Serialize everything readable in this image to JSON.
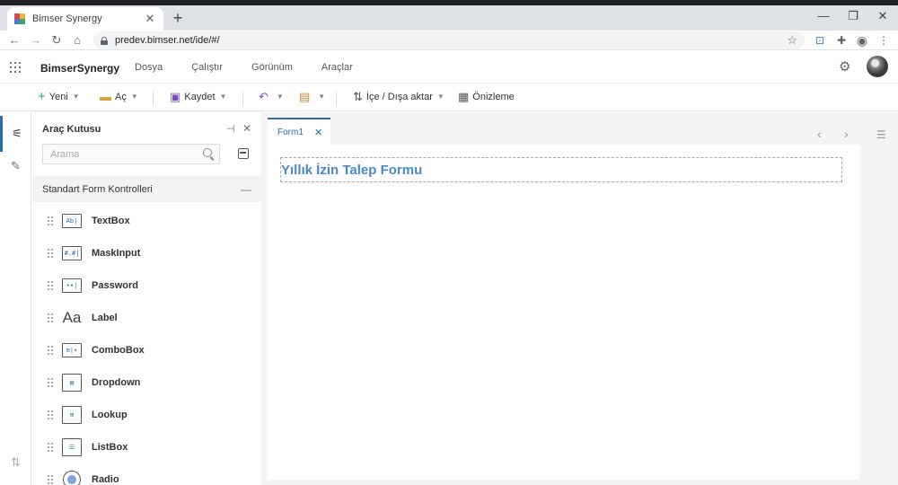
{
  "browser": {
    "tab_title": "Bimser Synergy",
    "tab_close": "✕",
    "new_tab": "+",
    "url": "predev.bimser.net/ide/#/",
    "controls": {
      "minimize": "—",
      "restore": "❐",
      "close": "✕"
    }
  },
  "app": {
    "brand": "BimserSynergy",
    "menu": [
      "Dosya",
      "Çalıştır",
      "Görünüm",
      "Araçlar"
    ]
  },
  "toolbar": {
    "new_label": "Yeni",
    "open_label": "Aç",
    "save_label": "Kaydet",
    "import_export_label": "İçe / Dışa aktar",
    "preview_label": "Önizleme"
  },
  "toolbox": {
    "title": "Araç Kutusu",
    "search_placeholder": "Arama",
    "section_label": "Standart Form Kontrolleri",
    "controls": [
      {
        "label": "TextBox",
        "icon_text": "Ab|"
      },
      {
        "label": "MaskInput",
        "icon_text": "#.#|"
      },
      {
        "label": "Password",
        "icon_text": "••|"
      },
      {
        "label": "Label",
        "icon_text": "Aa"
      },
      {
        "label": "ComboBox",
        "icon_text": "≡|▾"
      },
      {
        "label": "Dropdown",
        "icon_text": "▤"
      },
      {
        "label": "Lookup",
        "icon_text": "⊞"
      },
      {
        "label": "ListBox",
        "icon_text": "☰"
      },
      {
        "label": "Radio",
        "icon_text": ""
      }
    ]
  },
  "designer": {
    "doc_tab_label": "Form1",
    "doc_tab_close": "✕",
    "form_title": "Yıllık İzin Talep Formu"
  },
  "colors": {
    "accent": "#2b6cb0",
    "form_title": "#4a89c8"
  }
}
